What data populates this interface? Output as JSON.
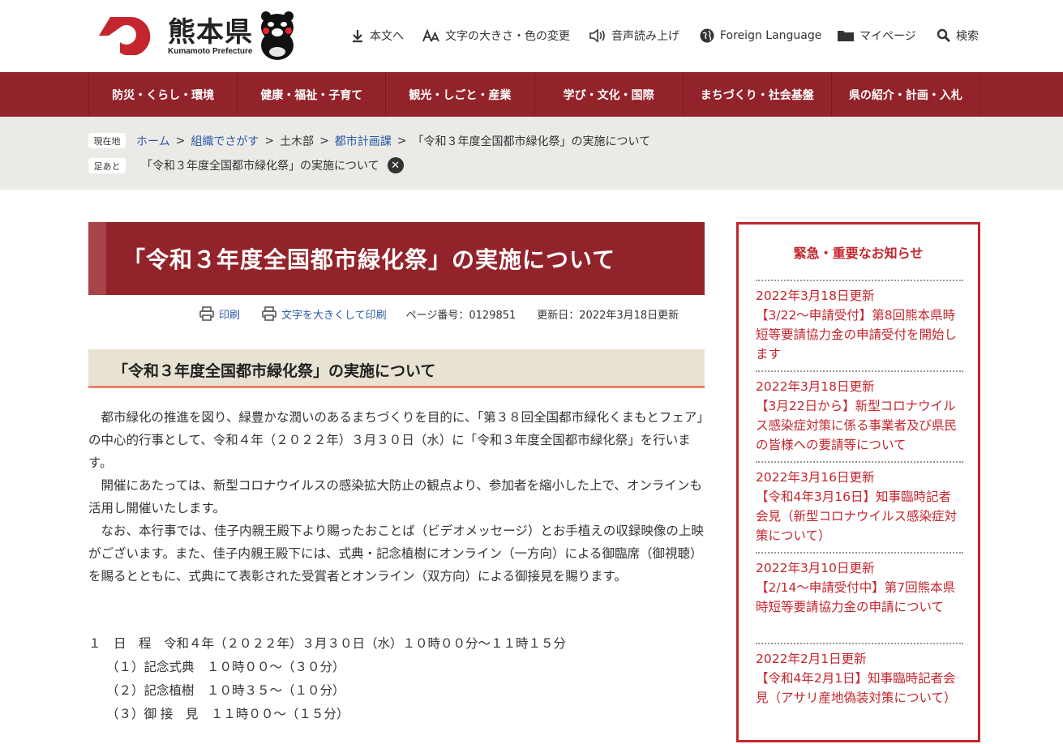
{
  "header": {
    "pref_name": "熊本県",
    "pref_name_en": "Kumamoto Prefecture",
    "utilities": [
      {
        "label": "本文へ",
        "icon": "download-arrow-icon"
      },
      {
        "label": "文字の大きさ・色の変更",
        "icon": "text-size-icon"
      },
      {
        "label": "音声読み上げ",
        "icon": "speaker-icon"
      },
      {
        "label": "Foreign Language",
        "icon": "globe-icon"
      },
      {
        "label": "マイページ",
        "icon": "folder-icon"
      },
      {
        "label": "検索",
        "icon": "search-icon"
      }
    ]
  },
  "nav": {
    "items": [
      "防災・くらし・環境",
      "健康・福祉・子育て",
      "観光・しごと・産業",
      "学び・文化・国際",
      "まちづくり・社会基盤",
      "県の紹介・計画・入札"
    ]
  },
  "breadcrumb": {
    "current_tag": "現在地",
    "items": [
      "ホーム",
      "組織でさがす",
      "土木部",
      "都市計画課"
    ],
    "current": "「令和３年度全国都市緑化祭」の実施について",
    "history_tag": "足あと",
    "history_item": "「令和３年度全国都市緑化祭」の実施について"
  },
  "page": {
    "title": "「令和３年度全国都市緑化祭」の実施について",
    "print_label": "印刷",
    "large_print_label": "文字を大きくして印刷",
    "page_number": "ページ番号：0129851",
    "updated": "更新日：2022年3月18日更新",
    "subheading": "「令和３年度全国都市緑化祭」の実施について",
    "paragraphs": [
      "都市緑化の推進を図り、緑豊かな潤いのあるまちづくりを目的に、「第３８回全国都市緑化くまもとフェア」の中心的行事として、令和４年（２０２２年）３月３０日（水）に「令和３年度全国都市緑化祭」を行います。",
      "開催にあたっては、新型コロナウイルスの感染拡大防止の観点より、参加者を縮小した上で、オンラインも活用し開催いたします。",
      "なお、本行事では、佳子内親王殿下より賜ったおことば（ビデオメッセージ）とお手植えの収録映像の上映がございます。また、佳子内親王殿下には、式典・記念植樹にオンライン（一方向）による御臨席（御視聴）を賜るとともに、式典にて表彰された受賞者とオンライン（双方向）による御接見を賜ります。"
    ],
    "schedule": {
      "heading": "１　日　程　令和４年（２０２２年）３月３０日（水）１０時００分～１１時１５分",
      "items": [
        "（１）記念式典　１０時００～（３０分）",
        "（２）記念植樹　１０時３５～（１０分）",
        "（３）御 接　見　１１時００～（１５分）"
      ]
    }
  },
  "sidebar": {
    "title": "緊急・重要なお知らせ",
    "news": [
      {
        "date": "2022年3月18日更新",
        "text": "【3/22～申請受付】第8回熊本県時短等要請協力金の申請受付を開始します"
      },
      {
        "date": "2022年3月18日更新",
        "text": "【3月22日から】新型コロナウイルス感染症対策に係る事業者及び県民の皆様への要請等について"
      },
      {
        "date": "2022年3月16日更新",
        "text": "【令和4年3月16日】知事臨時記者会見（新型コロナウイルス感染症対策について）"
      },
      {
        "date": "2022年3月10日更新",
        "text": "【2/14～申請受付中】第7回熊本県時短等要請協力金の申請について"
      },
      {
        "date": "2022年2月1日更新",
        "text": "【令和4年2月1日】知事臨時記者会見（アサリ産地偽装対策について）"
      }
    ]
  },
  "colors": {
    "brand_red": "#93232a",
    "accent_red": "#c4262e",
    "link_blue": "#2a5aa6",
    "crumb_bg": "#ebeae7",
    "subhead_bg": "#e8e2d2"
  }
}
